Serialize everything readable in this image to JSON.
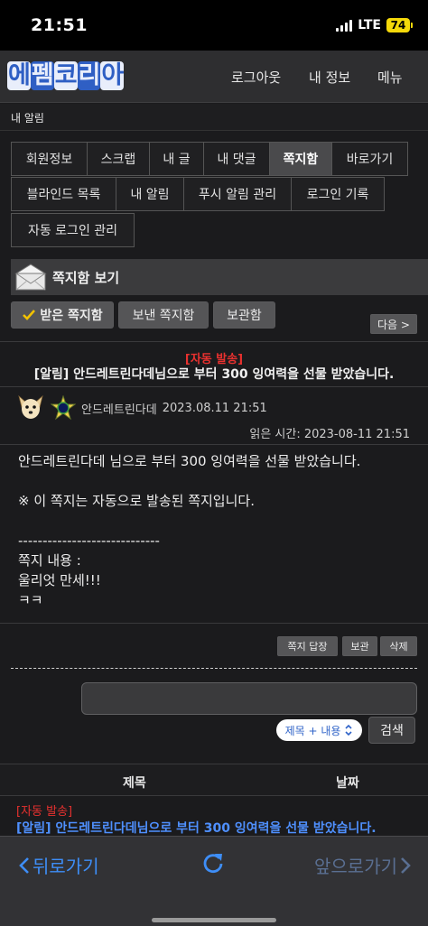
{
  "status": {
    "time": "21:51",
    "network": "LTE",
    "battery": "74"
  },
  "header": {
    "logo": [
      "에",
      "펨",
      "코",
      "리",
      "아"
    ],
    "nav": [
      "로그아웃",
      "내 정보",
      "메뉴"
    ]
  },
  "breadcrumb": "내 알림",
  "tabs": {
    "row1": [
      "회원정보",
      "스크랩",
      "내 글",
      "내 댓글",
      "쪽지함",
      "바로가기"
    ],
    "row2": [
      "블라인드 목록",
      "내 알림",
      "푸시 알림 관리",
      "로그인 기록"
    ],
    "row3": [
      "자동 로그인 관리"
    ],
    "active": "쪽지함"
  },
  "msgbox": {
    "title": "쪽지함 보기",
    "filters": [
      "받은 쪽지함",
      "보낸 쪽지함",
      "보관함"
    ],
    "next": "다음 >"
  },
  "message": {
    "auto_tag": "[자동 발송]",
    "subject": "[알림] 안드레트린다데님으로 부터 300 잉여력을 선물 받았습니다.",
    "sender": "안드레트린다데",
    "date": "2023.08.11 21:51",
    "read_time": "읽은 시간: 2023-08-11 21:51",
    "body": [
      "안드레트린다데 님으로 부터 300 잉여력을 선물 받았습니다.",
      "",
      "※ 이 쪽지는 자동으로 발송된 쪽지입니다.",
      "",
      "-----------------------------",
      "쪽지 내용 :",
      "울리엇 만세!!!",
      "ㅋㅋ"
    ],
    "actions": [
      "쪽지 답장",
      "보관",
      "삭제"
    ]
  },
  "search": {
    "placeholder": "",
    "scope": "제목 + 내용",
    "button": "검색"
  },
  "list": {
    "columns": [
      "제목",
      "날짜"
    ],
    "rows": [
      {
        "tag": "[자동 발송]",
        "subject": "[알림] 안드레트린다데님으로 부터 300 잉여력을 선물 받았습니다."
      }
    ]
  },
  "browser": {
    "back": "뒤로가기",
    "forward": "앞으로가기"
  },
  "colors": {
    "accent": "#3e8ef7",
    "alert": "#e8312f",
    "link": "#4f90ff",
    "battery": "#f5d90a"
  }
}
